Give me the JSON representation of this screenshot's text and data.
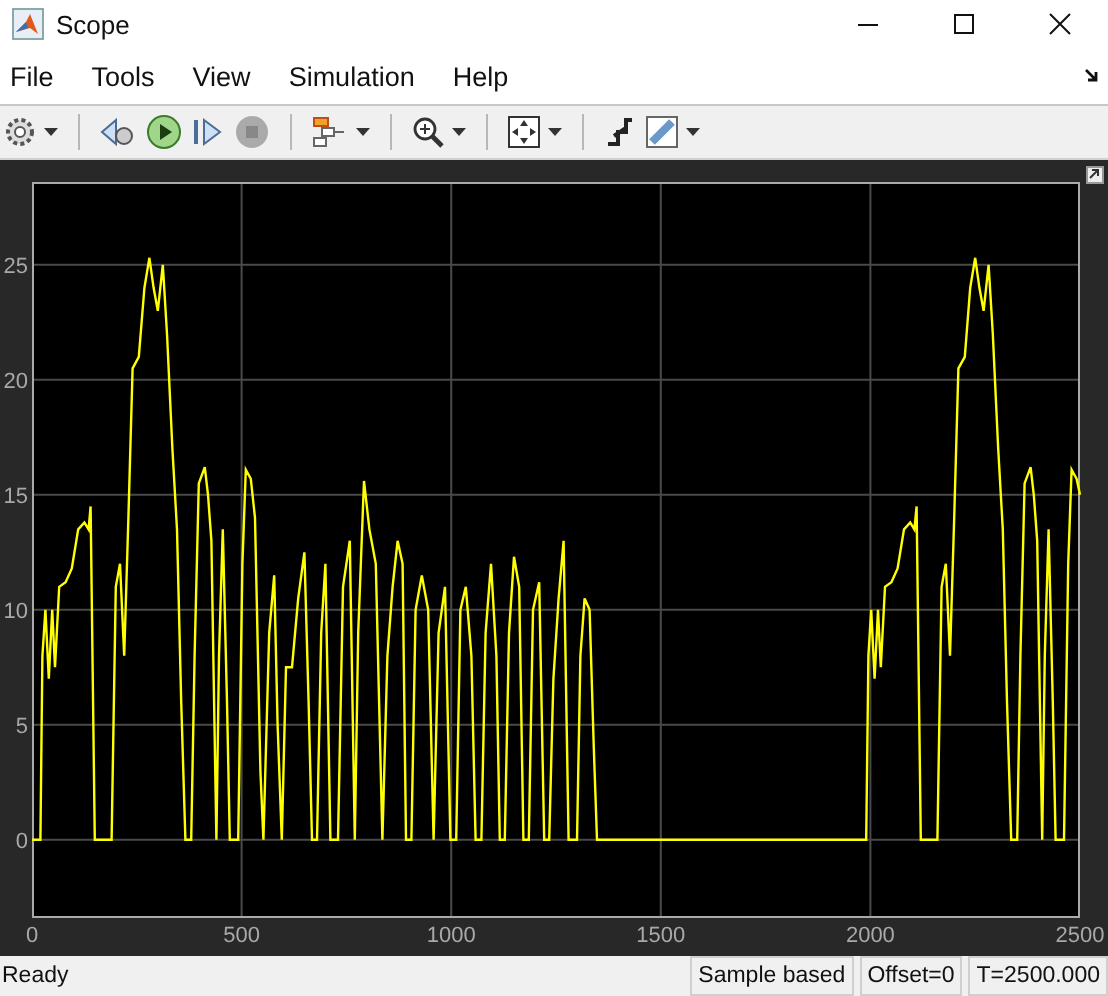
{
  "window": {
    "title": "Scope"
  },
  "menu": [
    "File",
    "Tools",
    "View",
    "Simulation",
    "Help"
  ],
  "plot": {
    "chart_data": {
      "type": "line",
      "grid": true,
      "xlim": [
        0,
        2500
      ],
      "ylim": [
        -3.4,
        28.6
      ],
      "xticks": [
        0,
        500,
        1000,
        1500,
        2000,
        2500
      ],
      "yticks": [
        25,
        20,
        15,
        10,
        5,
        0
      ],
      "x": [
        0,
        20,
        25,
        32,
        40,
        48,
        55,
        65,
        80,
        95,
        110,
        125,
        135,
        140,
        150,
        190,
        200,
        210,
        220,
        230,
        240,
        255,
        268,
        280,
        290,
        300,
        312,
        322,
        335,
        346,
        356,
        366,
        380,
        388,
        398,
        412,
        420,
        428,
        440,
        446,
        455,
        465,
        472,
        492,
        502,
        510,
        522,
        532,
        545,
        552,
        566,
        578,
        586,
        596,
        606,
        620,
        635,
        650,
        660,
        668,
        680,
        690,
        700,
        712,
        730,
        742,
        758,
        770,
        778,
        792,
        805,
        820,
        836,
        848,
        860,
        872,
        884,
        892,
        905,
        915,
        930,
        945,
        958,
        970,
        985,
        998,
        1012,
        1022,
        1035,
        1048,
        1058,
        1072,
        1082,
        1095,
        1108,
        1116,
        1128,
        1138,
        1150,
        1162,
        1172,
        1185,
        1195,
        1210,
        1222,
        1234,
        1244,
        1256,
        1268,
        1280,
        1300,
        1308,
        1318,
        1330,
        1340,
        1348,
        1990,
        1995,
        2002,
        2010,
        2018,
        2025,
        2035,
        2050,
        2065,
        2080,
        2095,
        2105,
        2110,
        2120,
        2160,
        2170,
        2180,
        2190,
        2200,
        2210,
        2225,
        2238,
        2250,
        2260,
        2270,
        2282,
        2292,
        2305,
        2316,
        2326,
        2336,
        2350,
        2358,
        2368,
        2382,
        2390,
        2398,
        2410,
        2416,
        2425,
        2435,
        2442,
        2462,
        2472,
        2480,
        2492,
        2500
      ],
      "series": [
        {
          "color": "#ffff00",
          "values": [
            0,
            0,
            8,
            10,
            7,
            10,
            7.5,
            11,
            11.2,
            11.8,
            13.5,
            13.8,
            13.5,
            14.5,
            0,
            0,
            11,
            12,
            8,
            14,
            20.5,
            21,
            24,
            25.3,
            24,
            23,
            25,
            22,
            17,
            13.5,
            6,
            0,
            0,
            8,
            15.5,
            16.2,
            15,
            13,
            0,
            8,
            13.5,
            6,
            0,
            0,
            12,
            16.1,
            15.7,
            14,
            3,
            0,
            9,
            11.5,
            5,
            0,
            7.5,
            7.5,
            10.5,
            12.5,
            6,
            0,
            0,
            9,
            12,
            0,
            0,
            11,
            13,
            0,
            9,
            15.6,
            13.5,
            12,
            0,
            8,
            11,
            13,
            12,
            0,
            0,
            10,
            11.5,
            10,
            0,
            9,
            11,
            0,
            0,
            10,
            11,
            8,
            0,
            0,
            9,
            12,
            8,
            0,
            0,
            9,
            12.3,
            11,
            0,
            0,
            10,
            11.2,
            0,
            0,
            7,
            10.5,
            13,
            0,
            0,
            8,
            10.5,
            10,
            4,
            0,
            0,
            8,
            10,
            7,
            10,
            7.5,
            11,
            11.2,
            11.8,
            13.5,
            13.8,
            13.5,
            14.5,
            0,
            0,
            11,
            12,
            8,
            14,
            20.5,
            21,
            24,
            25.3,
            24,
            23,
            25,
            22,
            17,
            13.5,
            6,
            0,
            0,
            8,
            15.5,
            16.2,
            15,
            13,
            0,
            8,
            13.5,
            6,
            0,
            0,
            12,
            16.1,
            15.7,
            15
          ]
        }
      ]
    }
  },
  "status_bar": {
    "message": "Ready",
    "fields": [
      "Sample based",
      "Offset=0",
      "T=2500.000"
    ]
  }
}
